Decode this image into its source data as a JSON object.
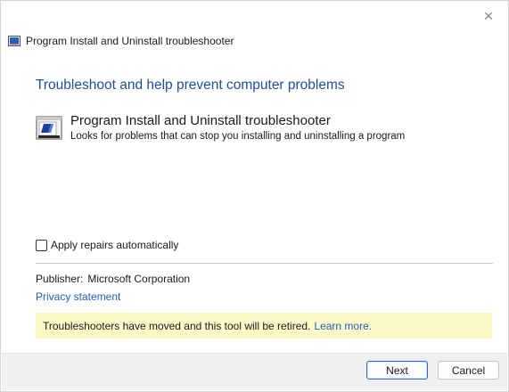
{
  "window": {
    "title": "Program Install and Uninstall troubleshooter",
    "close_glyph": "✕"
  },
  "main": {
    "heading": "Troubleshoot and help prevent computer problems",
    "item": {
      "title": "Program Install and Uninstall troubleshooter",
      "description": "Looks for problems that can stop you installing and uninstalling a program"
    },
    "apply_repairs": {
      "label": "Apply repairs automatically",
      "checked": false
    },
    "publisher": {
      "label": "Publisher:",
      "value": "Microsoft Corporation"
    },
    "privacy_link": "Privacy statement",
    "banner": {
      "text": "Troubleshooters have moved and this tool will be retired.",
      "link": "Learn more."
    }
  },
  "footer": {
    "next_label": "Next",
    "cancel_label": "Cancel"
  },
  "colors": {
    "heading": "#1f4e99",
    "link": "#1f5fbf",
    "banner_bg": "#fcf9c8",
    "footer_bg": "#f0f0f0",
    "primary_border": "#2b6fd6"
  },
  "icons": {
    "title_icon": "troubleshooter-icon",
    "item_icon": "install-program-icon",
    "close_icon": "close-icon"
  }
}
